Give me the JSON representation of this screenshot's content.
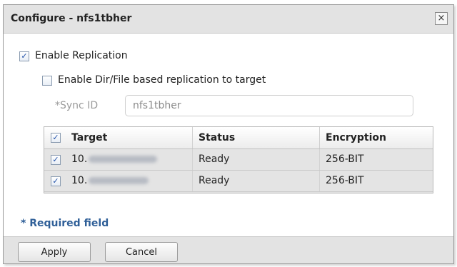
{
  "dialog": {
    "title": "Configure - nfs1tbher",
    "close_glyph": "×"
  },
  "options": {
    "enable_replication": {
      "label": "Enable Replication",
      "checked": true
    },
    "enable_dirfile": {
      "label": "Enable Dir/File based replication to target",
      "checked": false
    }
  },
  "sync": {
    "label": "*Sync ID",
    "value": "nfs1tbher"
  },
  "table": {
    "headers": [
      "Target",
      "Status",
      "Encryption"
    ],
    "select_all_checked": true,
    "rows": [
      {
        "checked": true,
        "target": "10.",
        "status": "Ready",
        "encryption": "256-BIT"
      },
      {
        "checked": true,
        "target": "10.",
        "status": "Ready",
        "encryption": "256-BIT"
      }
    ]
  },
  "required_note": "* Required field",
  "buttons": {
    "apply": "Apply",
    "cancel": "Cancel"
  },
  "colors": {
    "accent": "#2f5f98",
    "titlebar": "#e3e3e3",
    "row_bg": "#e4e4e4"
  }
}
